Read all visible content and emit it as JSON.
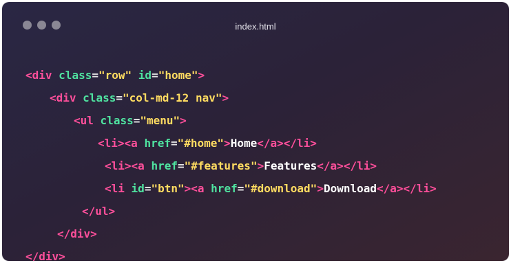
{
  "window": {
    "title": "index.html"
  },
  "colors": {
    "tag": "#ff4f9b",
    "attribute": "#4fe3a0",
    "string": "#ffdc61",
    "text": "#ffffff"
  },
  "code": {
    "l1": {
      "open": "<div",
      "a1": "class",
      "v1": "\"row\"",
      "a2": "id",
      "v2": "\"home\"",
      "close": ">"
    },
    "l2": {
      "open": "<div",
      "a1": "class",
      "v1": "\"col-md-12 nav\"",
      "close": ">"
    },
    "l3": {
      "open": "<ul",
      "a1": "class",
      "v1": "\"menu\"",
      "close": ">"
    },
    "l4": {
      "open": "<li><a",
      "a1": "href",
      "v1": "\"#home\"",
      "close": ">",
      "text": "Home",
      "end": "</a></li>"
    },
    "l5": {
      "open": "<li><a",
      "a1": "href",
      "v1": "\"#features\"",
      "close": ">",
      "text": "Features",
      "end": "</a></li>"
    },
    "l6": {
      "open": "<li",
      "a1": "id",
      "v1": "\"btn\"",
      "mid": "><a",
      "a2": "href",
      "v2": "\"#download\"",
      "close": ">",
      "text": "Download",
      "end": "</a></li>"
    },
    "l7": {
      "end": "</ul>"
    },
    "l8": {
      "end": "</div>"
    },
    "l9": {
      "end": "</div>"
    }
  }
}
